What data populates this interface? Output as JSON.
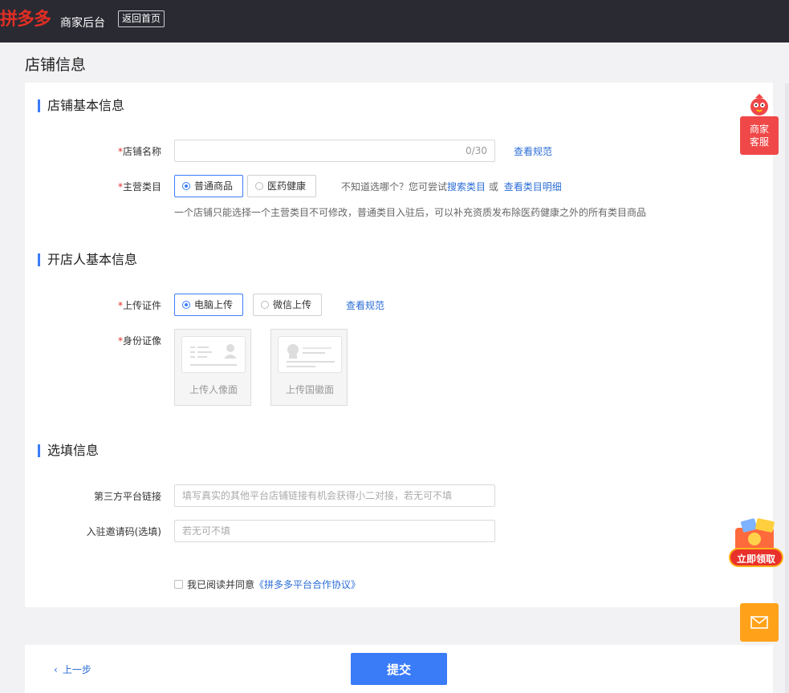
{
  "header": {
    "logo": "拼多多",
    "subtitle": "商家后台",
    "home_button": "返回首页"
  },
  "page_title": "店铺信息",
  "section_basic": {
    "title": "店铺基本信息",
    "shop_name": {
      "required_mark": "*",
      "label": "店铺名称",
      "value": "",
      "counter": "0/30",
      "help_link": "查看规范"
    },
    "category": {
      "required_mark": "*",
      "label": "主营类目",
      "options": [
        "普通商品",
        "医药健康"
      ],
      "selected": "普通商品",
      "hint_prefix": "不知道选哪个？您可尝试",
      "search_link": "搜索类目",
      "or_text": "或",
      "detail_link": "查看类目明细",
      "note": "一个店铺只能选择一个主营类目不可修改，普通类目入驻后，可以补充资质发布除医药健康之外的所有类目商品"
    }
  },
  "section_owner": {
    "title": "开店人基本信息",
    "upload_cert": {
      "required_mark": "*",
      "label": "上传证件",
      "options": [
        "电脑上传",
        "微信上传"
      ],
      "selected": "电脑上传",
      "help_link": "查看规范"
    },
    "id_photo": {
      "required_mark": "*",
      "label": "身份证像",
      "portrait_label": "上传人像面",
      "emblem_label": "上传国徽面"
    }
  },
  "section_optional": {
    "title": "选填信息",
    "third_party_link": {
      "label": "第三方平台链接",
      "placeholder": "填写真实的其他平台店铺链接有机会获得小二对接，若无可不填"
    },
    "invite_code": {
      "label": "入驻邀请码(选填)",
      "placeholder": "若无可不填"
    }
  },
  "agreement": {
    "checked": false,
    "prefix": "我已阅读并同意",
    "link": "《拼多多平台合作协议》"
  },
  "footer": {
    "prev_label": "上一步",
    "submit_label": "提交"
  },
  "side": {
    "service_label": "商家客服",
    "gift_label": "立即领取",
    "mail_icon": "mail-icon"
  },
  "colors": {
    "accent": "#3a7cf8",
    "brand_red": "#e02e24",
    "link": "#2c6ed6",
    "topbar": "#2a2a33"
  }
}
